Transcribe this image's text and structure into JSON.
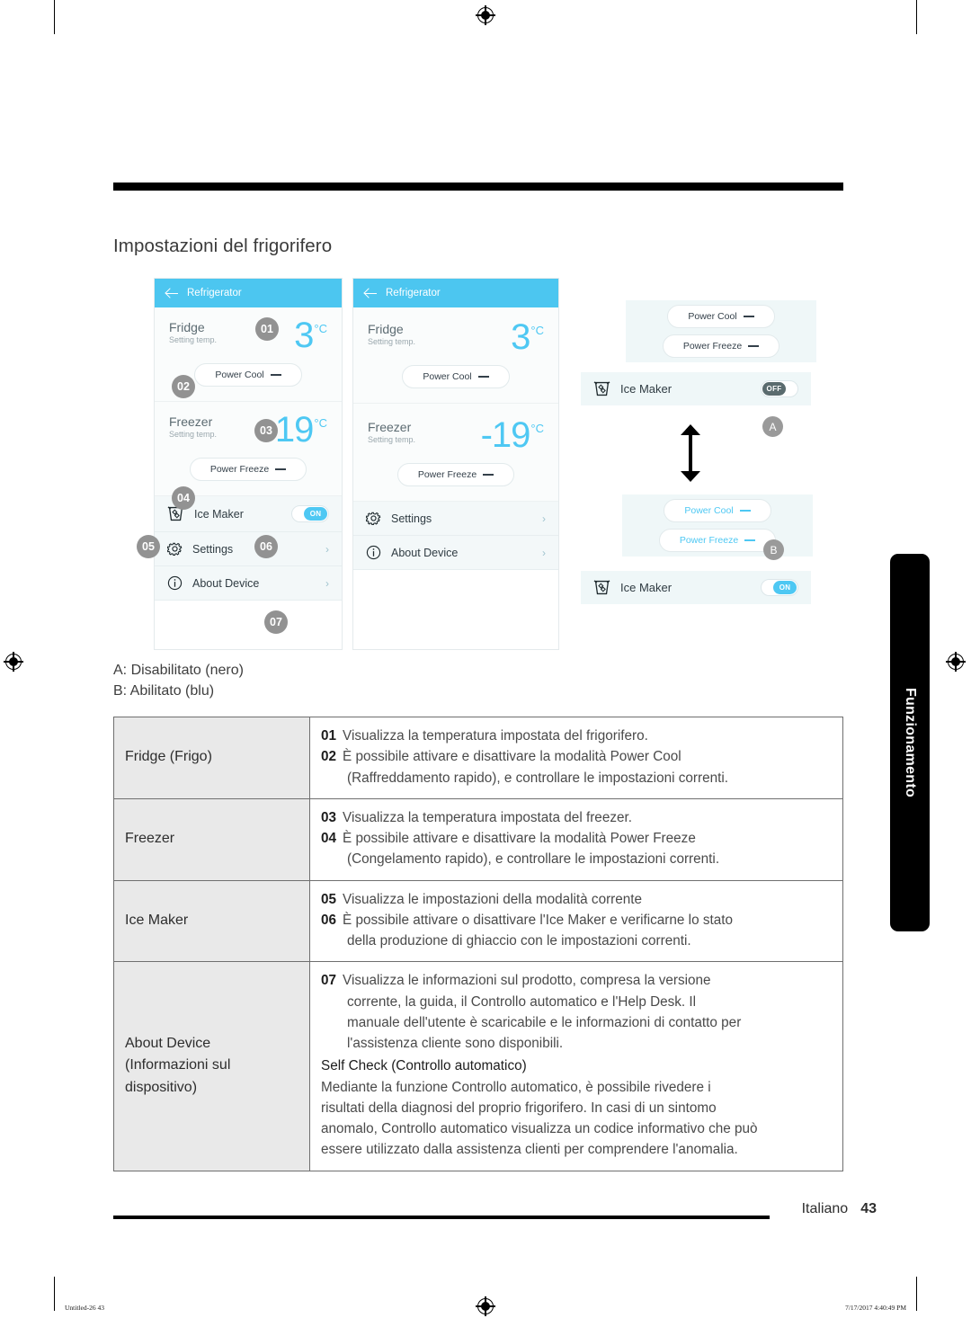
{
  "section": {
    "title": "Impostazioni del frigorifero"
  },
  "phone_left": {
    "header": {
      "title": "Refrigerator",
      "back_icon": "arrow-left-icon"
    },
    "fridge": {
      "name": "Fridge",
      "sub": "Setting temp.",
      "temp": "3",
      "unit": "°C",
      "badge": "01"
    },
    "power_cool": {
      "label": "Power Cool",
      "badge": "02"
    },
    "freezer": {
      "name": "Freezer",
      "sub": "Setting temp.",
      "temp": "-19",
      "unit": "°C",
      "badge": "03"
    },
    "power_freeze": {
      "label": "Power Freeze",
      "badge": "04"
    },
    "ice_maker": {
      "label": "Ice Maker",
      "badge_left": "05",
      "badge_right": "06",
      "toggle": "ON"
    },
    "settings": {
      "label": "Settings",
      "chevron": "chevron-right-icon"
    },
    "about": {
      "label": "About Device",
      "badge": "07",
      "chevron": "chevron-right-icon"
    }
  },
  "phone_mid": {
    "header": {
      "title": "Refrigerator",
      "back_icon": "arrow-left-icon"
    },
    "fridge": {
      "name": "Fridge",
      "sub": "Setting temp.",
      "temp": "3",
      "unit": "°C"
    },
    "power_cool": {
      "label": "Power Cool"
    },
    "freezer": {
      "name": "Freezer",
      "sub": "Setting temp.",
      "temp": "-19",
      "unit": "°C"
    },
    "power_freeze": {
      "label": "Power Freeze"
    },
    "settings": {
      "label": "Settings"
    },
    "about": {
      "label": "About Device"
    }
  },
  "diagram": {
    "state_a": {
      "power_cool": "Power Cool",
      "power_freeze": "Power Freeze",
      "ice_maker": "Ice Maker",
      "toggle": "OFF",
      "marker": "A"
    },
    "state_b": {
      "power_cool": "Power Cool",
      "power_freeze": "Power Freeze",
      "ice_maker": "Ice Maker",
      "toggle": "ON",
      "marker": "B"
    }
  },
  "legend": {
    "line_a": "A: Disabilitato (nero)",
    "line_b": "B: Abilitato (blu)"
  },
  "table": {
    "rows": [
      {
        "name": "Fridge (Frigo)",
        "name_extra": "",
        "items": [
          {
            "num": "01",
            "text": "Visualizza la temperatura impostata del frigorifero.",
            "cont": ""
          },
          {
            "num": "02",
            "text": "È possibile attivare e disattivare la modalità Power Cool",
            "cont": "(Raffreddamento rapido), e controllare le impostazioni correnti."
          }
        ]
      },
      {
        "name": "Freezer",
        "name_extra": "",
        "items": [
          {
            "num": "03",
            "text": "Visualizza la temperatura impostata del freezer.",
            "cont": ""
          },
          {
            "num": "04",
            "text": "È possibile attivare e disattivare la modalità Power Freeze",
            "cont": "(Congelamento rapido), e controllare le impostazioni correnti."
          }
        ]
      },
      {
        "name": "Ice Maker",
        "name_extra": "",
        "items": [
          {
            "num": "05",
            "text": "Visualizza le impostazioni della modalità corrente",
            "cont": ""
          },
          {
            "num": "06",
            "text": "È possibile attivare o disattivare l'Ice Maker e verificarne lo stato",
            "cont": "della produzione di ghiaccio con le impostazioni correnti."
          }
        ]
      }
    ],
    "about_row": {
      "name": "About Device",
      "name_line2": "(Informazioni sul",
      "name_line3": "dispositivo)",
      "item_num": "07",
      "item_text": "Visualizza le informazioni sul prodotto, compresa la versione",
      "item_cont_1": "corrente, la guida, il Controllo automatico e l'Help Desk. Il",
      "item_cont_2": "manuale dell'utente è scaricabile e le informazioni di contatto per",
      "item_cont_3": "l'assistenza cliente sono disponibili.",
      "subheading": "Self Check (Controllo automatico)",
      "body_1": "Mediante la funzione Controllo automatico, è possibile rivedere i",
      "body_2": "risultati della diagnosi del proprio frigorifero. In casi di un sintomo",
      "body_3": "anomalo, Controllo automatico visualizza un codice informativo che può",
      "body_4": "essere utilizzato dalla assistenza clienti per comprendere l'anomalia."
    }
  },
  "side_tab": {
    "label": "Funzionamento"
  },
  "footer": {
    "language": "Italiano",
    "page": "43"
  },
  "print_slug": {
    "left": "Untitled-26   43",
    "right": "7/17/2017   4:40:49 PM"
  },
  "colors": {
    "accent_cyan": "#4ec8f3",
    "header_cyan": "#4cc6f0",
    "badge_grey": "#929292",
    "toggle_off": "#5a6b6e",
    "table_header_bg": "#e9e9e9"
  }
}
